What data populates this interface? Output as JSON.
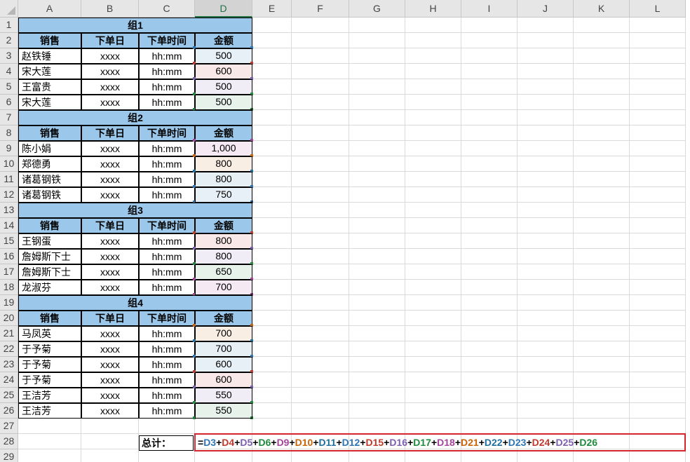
{
  "columns": [
    "A",
    "B",
    "C",
    "D",
    "E",
    "F",
    "G",
    "H",
    "I",
    "J",
    "K",
    "L"
  ],
  "selected_column": "D",
  "rows": [
    "1",
    "2",
    "3",
    "4",
    "5",
    "6",
    "7",
    "8",
    "9",
    "10",
    "11",
    "12",
    "13",
    "14",
    "15",
    "16",
    "17",
    "18",
    "19",
    "20",
    "21",
    "22",
    "23",
    "24",
    "25",
    "26",
    "27",
    "28",
    "29"
  ],
  "table_headers": {
    "sales": "销售",
    "order_date": "下单日",
    "order_time": "下单时间",
    "amount": "金额"
  },
  "groups": [
    {
      "title": "组1",
      "rows": [
        {
          "name": "赵铁锤",
          "date": "xxxx",
          "time": "hh:mm",
          "amount": "500",
          "color": "#2e75b6"
        },
        {
          "name": "宋大莲",
          "date": "xxxx",
          "time": "hh:mm",
          "amount": "600",
          "color": "#c0392b"
        },
        {
          "name": "王富贵",
          "date": "xxxx",
          "time": "hh:mm",
          "amount": "500",
          "color": "#7d5fb2"
        },
        {
          "name": "宋大莲",
          "date": "xxxx",
          "time": "hh:mm",
          "amount": "500",
          "color": "#1e8a3c"
        }
      ]
    },
    {
      "title": "组2",
      "rows": [
        {
          "name": "陈小娟",
          "date": "xxxx",
          "time": "hh:mm",
          "amount": "1,000",
          "color": "#a4449a"
        },
        {
          "name": "郑德勇",
          "date": "xxxx",
          "time": "hh:mm",
          "amount": "800",
          "color": "#c8650a"
        },
        {
          "name": "诸葛钢铁",
          "date": "xxxx",
          "time": "hh:mm",
          "amount": "800",
          "color": "#1f6f9f"
        },
        {
          "name": "诸葛钢铁",
          "date": "xxxx",
          "time": "hh:mm",
          "amount": "750",
          "color": "#2e75b6"
        }
      ]
    },
    {
      "title": "组3",
      "rows": [
        {
          "name": "王钢蛋",
          "date": "xxxx",
          "time": "hh:mm",
          "amount": "800",
          "color": "#c0392b"
        },
        {
          "name": "詹姆斯下士",
          "date": "xxxx",
          "time": "hh:mm",
          "amount": "800",
          "color": "#7d5fb2"
        },
        {
          "name": "詹姆斯下士",
          "date": "xxxx",
          "time": "hh:mm",
          "amount": "650",
          "color": "#1e8a3c"
        },
        {
          "name": "龙淑芬",
          "date": "xxxx",
          "time": "hh:mm",
          "amount": "700",
          "color": "#a4449a"
        }
      ]
    },
    {
      "title": "组4",
      "rows": [
        {
          "name": "马凤英",
          "date": "xxxx",
          "time": "hh:mm",
          "amount": "700",
          "color": "#c8650a"
        },
        {
          "name": "于予菊",
          "date": "xxxx",
          "time": "hh:mm",
          "amount": "700",
          "color": "#1f6f9f"
        },
        {
          "name": "于予菊",
          "date": "xxxx",
          "time": "hh:mm",
          "amount": "600",
          "color": "#2e75b6"
        },
        {
          "name": "于予菊",
          "date": "xxxx",
          "time": "hh:mm",
          "amount": "600",
          "color": "#c0392b"
        },
        {
          "name": "王洁芳",
          "date": "xxxx",
          "time": "hh:mm",
          "amount": "550",
          "color": "#7d5fb2"
        },
        {
          "name": "王洁芳",
          "date": "xxxx",
          "time": "hh:mm",
          "amount": "550",
          "color": "#1e8a3c"
        }
      ]
    }
  ],
  "total_label": "总计：",
  "formula": {
    "prefix": "=",
    "refs": [
      {
        "ref": "D3",
        "color": "#2e75b6"
      },
      {
        "ref": "D4",
        "color": "#c0392b"
      },
      {
        "ref": "D5",
        "color": "#7d5fb2"
      },
      {
        "ref": "D6",
        "color": "#1e8a3c"
      },
      {
        "ref": "D9",
        "color": "#a4449a"
      },
      {
        "ref": "D10",
        "color": "#c8650a"
      },
      {
        "ref": "D11",
        "color": "#1f6f9f"
      },
      {
        "ref": "D12",
        "color": "#2e75b6"
      },
      {
        "ref": "D15",
        "color": "#c0392b"
      },
      {
        "ref": "D16",
        "color": "#7d5fb2"
      },
      {
        "ref": "D17",
        "color": "#1e8a3c"
      },
      {
        "ref": "D18",
        "color": "#a4449a"
      },
      {
        "ref": "D21",
        "color": "#c8650a"
      },
      {
        "ref": "D22",
        "color": "#1f6f9f"
      },
      {
        "ref": "D23",
        "color": "#2e75b6"
      },
      {
        "ref": "D24",
        "color": "#c0392b"
      },
      {
        "ref": "D25",
        "color": "#7d5fb2"
      },
      {
        "ref": "D26",
        "color": "#1e8a3c"
      }
    ],
    "separator": "+"
  },
  "colors": {
    "header_fill": "#9bc8ea",
    "highlight_box": "#d6252c",
    "selected_header": "#217346"
  }
}
